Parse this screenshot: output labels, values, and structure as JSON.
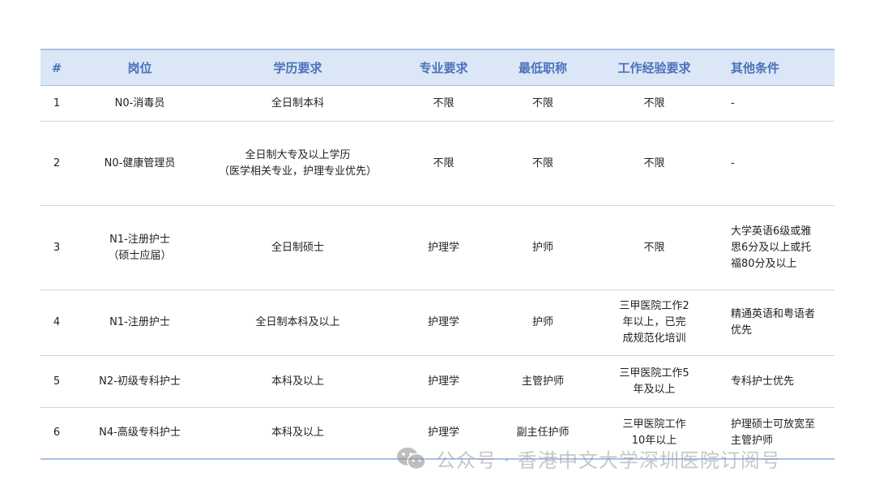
{
  "table": {
    "headers": [
      "#",
      "岗位",
      "学历要求",
      "专业要求",
      "最低职称",
      "工作经验要求",
      "其他条件"
    ],
    "rows": [
      {
        "num": "1",
        "position": "N0-消毒员",
        "education": "全日制本科",
        "major": "不限",
        "title": "不限",
        "experience": "不限",
        "other": "-"
      },
      {
        "num": "2",
        "position": "N0-健康管理员",
        "education": "全日制大专及以上学历\n（医学相关专业，护理专业优先）",
        "major": "不限",
        "title": "不限",
        "experience": "不限",
        "other": "-"
      },
      {
        "num": "3",
        "position": "N1-注册护士\n（硕士应届）",
        "education": "全日制硕士",
        "major": "护理学",
        "title": "护师",
        "experience": "不限",
        "other": "大学英语6级或雅思6分及以上或托福80分及以上"
      },
      {
        "num": "4",
        "position": "N1-注册护士",
        "education": "全日制本科及以上",
        "major": "护理学",
        "title": "护师",
        "experience": "三甲医院工作2年以上，已完成规范化培训",
        "other": "精通英语和粤语者优先"
      },
      {
        "num": "5",
        "position": "N2-初级专科护士",
        "education": "本科及以上",
        "major": "护理学",
        "title": "主管护师",
        "experience": "三甲医院工作5年及以上",
        "other": "专科护士优先"
      },
      {
        "num": "6",
        "position": "N4-高级专科护士",
        "education": "本科及以上",
        "major": "护理学",
        "title": "副主任护师",
        "experience": "三甲医院工作10年以上",
        "other": "护理硕士可放宽至主管护师"
      }
    ]
  },
  "watermark": {
    "text": "公众号 · 香港中文大学深圳医院订阅号",
    "icon": "wechat-icon"
  },
  "colors": {
    "header_bg": "#dbe6f7",
    "header_text": "#4a72b8",
    "rule": "#a8c1e6"
  }
}
